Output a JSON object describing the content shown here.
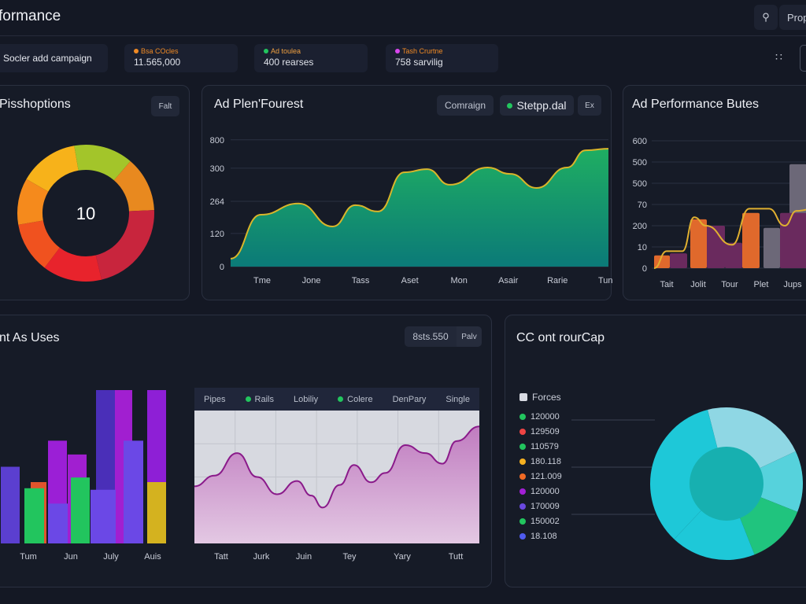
{
  "header": {
    "title": "formance",
    "search_icon": "search-icon",
    "prop_label": "Prop"
  },
  "kpis": [
    {
      "label": "",
      "value": "Socler add campaign"
    },
    {
      "label": "Bsa COcles",
      "value": "11.565,000",
      "color": "#f08a24"
    },
    {
      "label": "Ad toulea",
      "value": "400 rearses",
      "color": "#22c55e"
    },
    {
      "label": "Tash Crurtne",
      "value": "758 sarvilig",
      "color": "#d946ef"
    }
  ],
  "toolbar": {
    "grid_icon": "grid-icon"
  },
  "panel_donut": {
    "title": "Pisshoptions",
    "chip": "Falt",
    "center_value": "10",
    "chart_data": {
      "type": "pie",
      "donut": true,
      "values": [
        14,
        14,
        13,
        22,
        14,
        12,
        11
      ],
      "colors": [
        "#f7b21a",
        "#a3c52a",
        "#e8891f",
        "#c8253d",
        "#e8232c",
        "#f0521f",
        "#f58a1c"
      ]
    }
  },
  "panel_area": {
    "title": "Ad Plen'Fourest",
    "chips": [
      "Comraign",
      "Stetpp.dal",
      "Ex"
    ],
    "chip_dot": "#22c55e",
    "chart_data": {
      "type": "area",
      "ylim": [
        0,
        400
      ],
      "yticks": [
        {
          "label": "800",
          "v": 398
        },
        {
          "label": "300",
          "v": 309
        },
        {
          "label": "264",
          "v": 205
        },
        {
          "label": "120",
          "v": 104
        },
        {
          "label": "0",
          "v": 0
        }
      ],
      "categories": [
        "Tme",
        "Jone",
        "Tass",
        "Aset",
        "Mon",
        "Asair",
        "Rarie",
        "Tunt"
      ],
      "x": [
        0,
        0.08,
        0.18,
        0.27,
        0.33,
        0.39,
        0.46,
        0.52,
        0.58,
        0.68,
        0.74,
        0.81,
        0.89,
        0.94,
        1
      ],
      "values": [
        25,
        163,
        198,
        126,
        193,
        173,
        296,
        306,
        257,
        311,
        291,
        247,
        311,
        365,
        370
      ]
    }
  },
  "panel_combo": {
    "title": "Ad Performance Butes",
    "chart_data": {
      "type": "bar",
      "ylim": [
        0,
        6
      ],
      "yticks": [
        "0",
        "10",
        "200",
        "70",
        "500",
        "500",
        "600"
      ],
      "categories": [
        "Tait",
        "Jolit",
        "Tour",
        "Plet",
        "Jups"
      ],
      "bars": [
        {
          "v": 0.6,
          "c": "#e0692c"
        },
        {
          "v": 0.7,
          "c": "#6a2a5e"
        },
        {
          "v": 2.3,
          "c": "#e0692c"
        },
        {
          "v": 2.0,
          "c": "#6a2a5e"
        },
        {
          "v": 1.2,
          "c": "#6a2a5e"
        },
        {
          "v": 2.6,
          "c": "#e0692c"
        },
        {
          "v": 1.9,
          "c": "#6c6878"
        },
        {
          "v": 4.9,
          "c": "#6c6878"
        },
        {
          "v": 2.6,
          "c": "#6a2a5e"
        }
      ],
      "line": [
        0,
        0.8,
        0.8,
        2.4,
        2.0,
        1.1,
        2.8,
        2.8,
        2.0,
        2.7,
        2.8
      ]
    }
  },
  "panel_bars": {
    "title": "nt As Uses",
    "chips": [
      "8sts.550",
      "Palv"
    ],
    "chart_data": {
      "type": "bar",
      "ylim": [
        0,
        100
      ],
      "categories": [
        "Tum",
        "Jun",
        "July",
        "Auis"
      ],
      "bars": [
        {
          "v": 50,
          "c": "#5b3fd0"
        },
        {
          "v": 40,
          "c": "#e0532c"
        },
        {
          "v": 36,
          "c": "#22c55e"
        },
        {
          "v": 67,
          "c": "#9b1fd6"
        },
        {
          "v": 26,
          "c": "#6b48e6"
        },
        {
          "v": 58,
          "c": "#a11fd0"
        },
        {
          "v": 43,
          "c": "#22c55e"
        },
        {
          "v": 100,
          "c": "#4a2fb8"
        },
        {
          "v": 35,
          "c": "#6b48e6"
        },
        {
          "v": 100,
          "c": "#a11fd0"
        },
        {
          "v": 67,
          "c": "#6b48e6"
        },
        {
          "v": 100,
          "c": "#8e1fd6"
        },
        {
          "v": 40,
          "c": "#d4b21f"
        }
      ]
    },
    "inner": {
      "legend": [
        {
          "label": "Pipes"
        },
        {
          "label": "Rails",
          "dot": "#22c55e"
        },
        {
          "label": "Lobiliy"
        },
        {
          "label": "Colere",
          "dot": "#22c55e"
        },
        {
          "label": "DenPary"
        },
        {
          "label": "Single"
        }
      ],
      "chart_data": {
        "type": "area",
        "ylim": [
          0,
          100
        ],
        "categories": [
          "Tatt",
          "Jurk",
          "Juin",
          "Tey",
          "Yary",
          "Tutt"
        ],
        "x": [
          0,
          0.07,
          0.15,
          0.22,
          0.29,
          0.36,
          0.41,
          0.45,
          0.51,
          0.56,
          0.62,
          0.67,
          0.74,
          0.81,
          0.87,
          0.92,
          1
        ],
        "values": [
          43,
          51,
          68,
          50,
          37,
          47,
          36,
          27,
          44,
          59,
          46,
          53,
          74,
          68,
          60,
          77,
          88
        ]
      }
    }
  },
  "panel_pie": {
    "title": "CC ont rourCap",
    "legend_title": "Forces",
    "legend": [
      {
        "label": "120000",
        "color": "#22c55e"
      },
      {
        "label": "129509",
        "color": "#ef4444"
      },
      {
        "label": "110579",
        "color": "#22c55e"
      },
      {
        "label": "180.118",
        "color": "#f5b020"
      },
      {
        "label": "121.009",
        "color": "#f06a24"
      },
      {
        "label": "120000",
        "color": "#a21fd6"
      },
      {
        "label": "170009",
        "color": "#6a48e0"
      },
      {
        "label": "150002",
        "color": "#22c55e"
      },
      {
        "label": "18.108",
        "color": "#4f5bf0"
      }
    ],
    "chart_data": {
      "type": "pie",
      "donut": true,
      "values": [
        22,
        13,
        13,
        18,
        34
      ],
      "colors": [
        "#8fd7e4",
        "#56d2dc",
        "#20c47e",
        "#1ec8d8",
        "#1ec8d8"
      ],
      "inner_color": "#17b0b0"
    }
  }
}
